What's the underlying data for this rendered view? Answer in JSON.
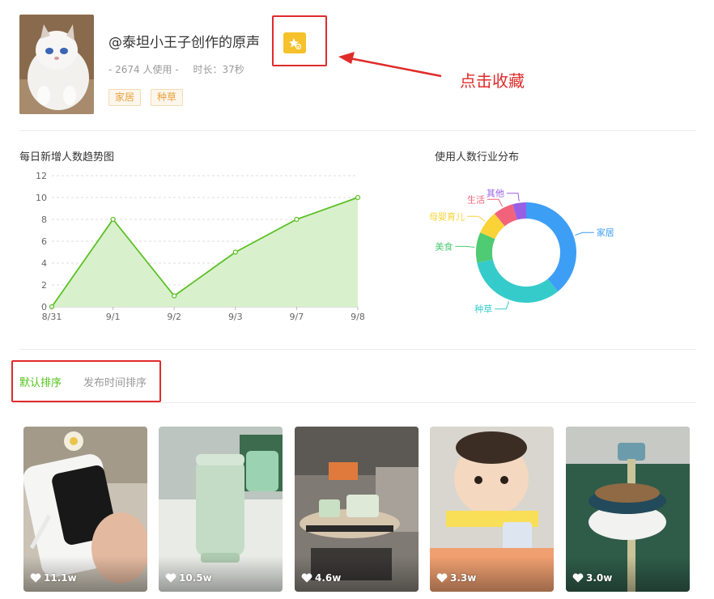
{
  "header": {
    "title": "@泰坦小王子创作的原声",
    "usage": "- 2674 人使用 -",
    "duration": "时长：37秒",
    "tags": [
      "家居",
      "种草"
    ],
    "favorite_icon": "star-folder-icon"
  },
  "annotation": {
    "text": "点击收藏",
    "color": "#e02b2b"
  },
  "trend": {
    "title": "每日新增人数趋势图"
  },
  "industry": {
    "title": "使用人数行业分布"
  },
  "chart_data": [
    {
      "type": "area",
      "categories": [
        "8/31",
        "9/1",
        "9/2",
        "9/3",
        "9/7",
        "9/8"
      ],
      "series": [
        {
          "values": [
            0,
            8,
            1,
            5,
            8,
            10
          ]
        }
      ],
      "ylim": [
        0,
        12
      ],
      "yticks": [
        "0",
        "2",
        "4",
        "6",
        "8",
        "10",
        "12"
      ],
      "grid": true,
      "colors": {
        "line": "#5cc026",
        "fill": "#d8f1cc"
      }
    },
    {
      "type": "pie",
      "donut": true,
      "labels": [
        "家居",
        "种草",
        "美食",
        "母婴育儿",
        "生活",
        "其他"
      ],
      "values": [
        36,
        30,
        9,
        7,
        6,
        4
      ],
      "colors": [
        "#3d9ef5",
        "#36cbcb",
        "#4ecb73",
        "#fad337",
        "#f2637b",
        "#975fe4"
      ]
    }
  ],
  "sort_tabs": [
    "默认排序",
    "发布时间排序"
  ],
  "videos": [
    {
      "likes": "11.1w"
    },
    {
      "likes": "10.5w"
    },
    {
      "likes": "4.6w"
    },
    {
      "likes": "3.3w"
    },
    {
      "likes": "3.0w"
    }
  ]
}
